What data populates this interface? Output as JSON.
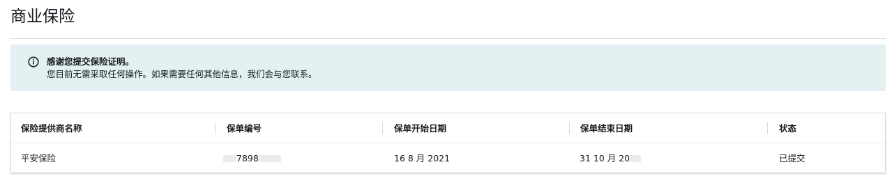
{
  "page": {
    "title": "商业保险"
  },
  "alert": {
    "icon": "info-icon",
    "title": "感谢您提交保险证明。",
    "message": "您目前无需采取任何操作。如果需要任何其他信息，我们会与您联系。",
    "background_color": "#e3f1f2"
  },
  "table": {
    "columns": [
      "保险提供商名称",
      "保单编号",
      "保单开始日期",
      "保单结束日期",
      "状态"
    ],
    "rows": [
      {
        "provider": "平安保险",
        "policy_number": "7898",
        "start_date": "16 8 月 2021",
        "end_date": "31 10 月 20",
        "status": "已提交"
      }
    ]
  }
}
